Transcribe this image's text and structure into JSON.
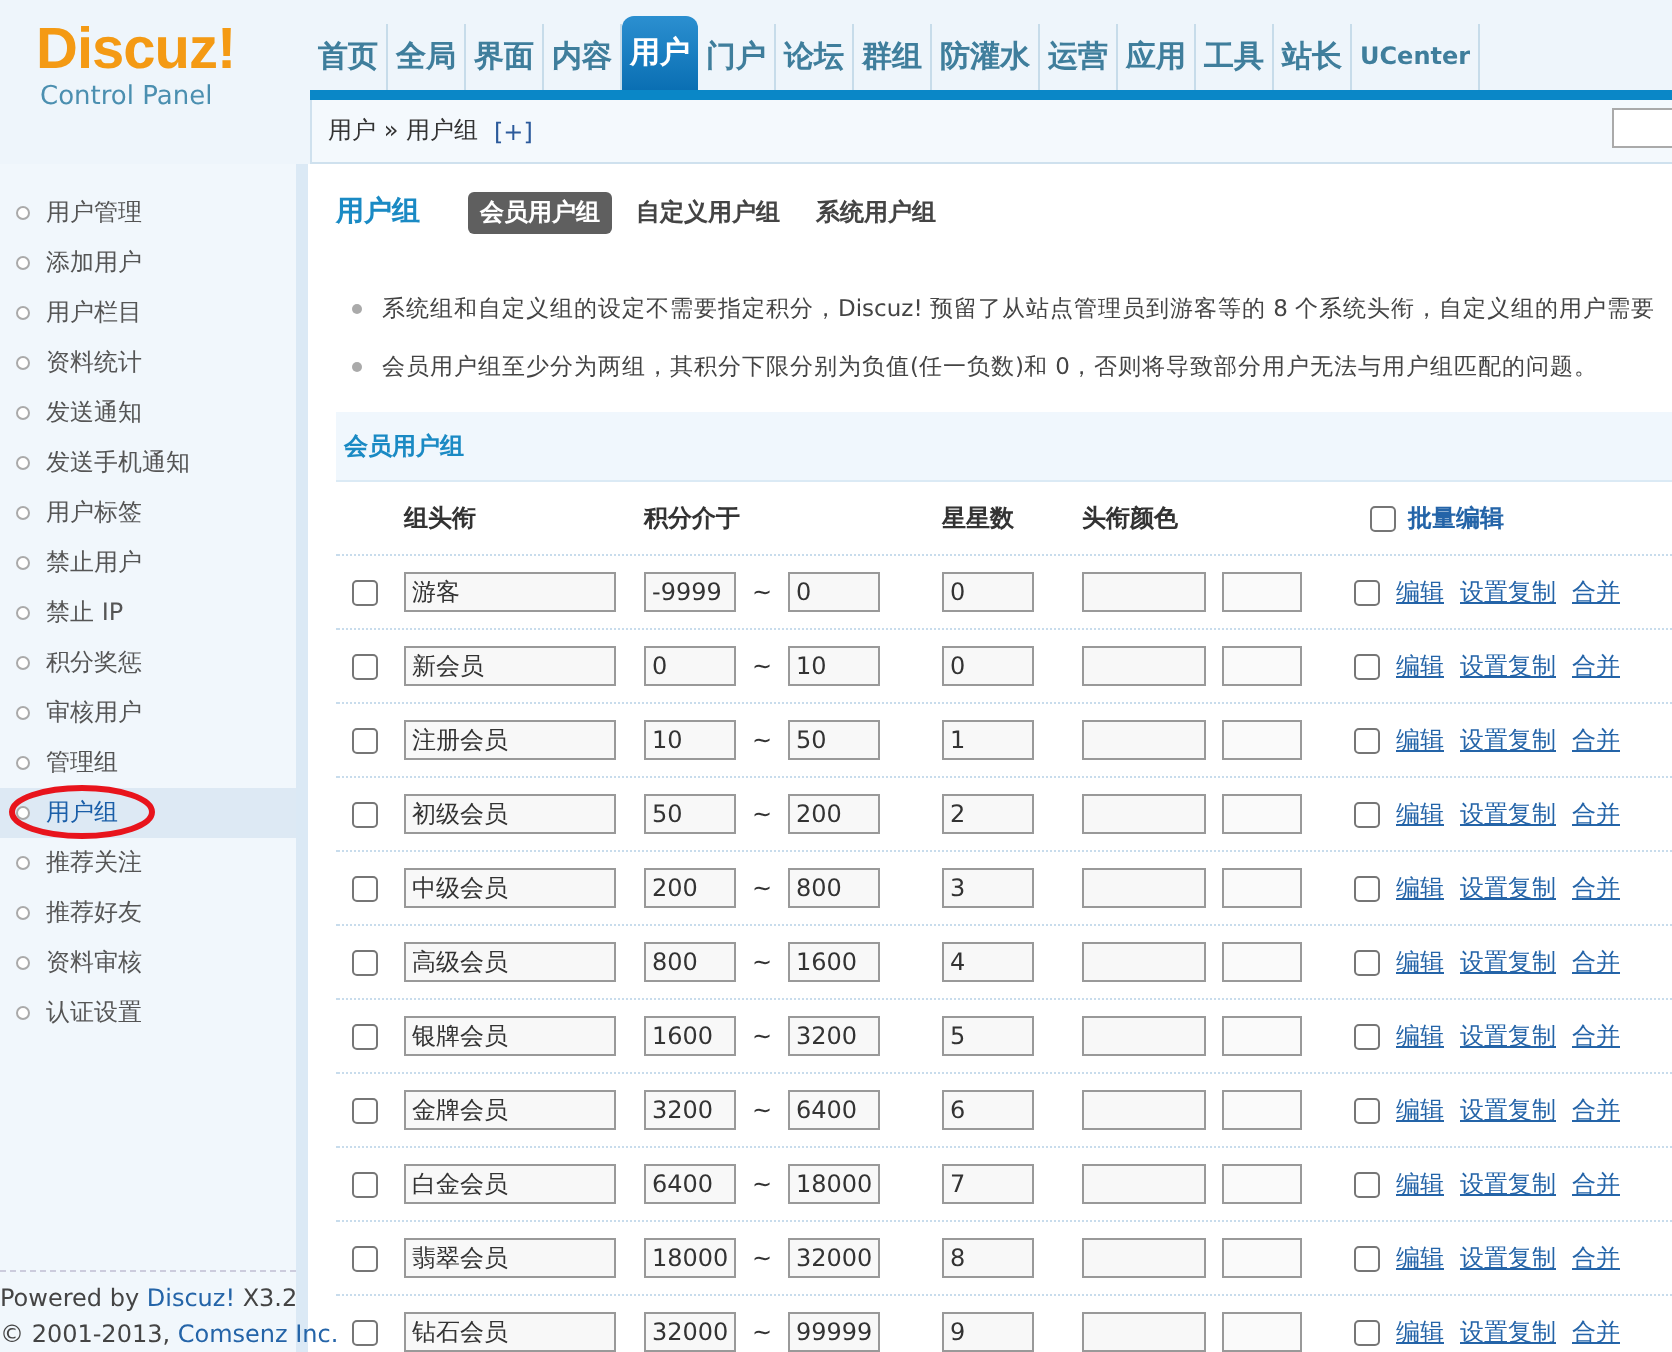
{
  "logo": {
    "name": "Discuz!",
    "subtitle": "Control Panel"
  },
  "nav": [
    {
      "label": "首页",
      "selected": false
    },
    {
      "label": "全局",
      "selected": false
    },
    {
      "label": "界面",
      "selected": false
    },
    {
      "label": "内容",
      "selected": false
    },
    {
      "label": "用户",
      "selected": true
    },
    {
      "label": "门户",
      "selected": false
    },
    {
      "label": "论坛",
      "selected": false
    },
    {
      "label": "群组",
      "selected": false
    },
    {
      "label": "防灌水",
      "selected": false
    },
    {
      "label": "运营",
      "selected": false
    },
    {
      "label": "应用",
      "selected": false
    },
    {
      "label": "工具",
      "selected": false
    },
    {
      "label": "站长",
      "selected": false
    },
    {
      "label": "UCenter",
      "selected": false
    }
  ],
  "breadcrumb": {
    "path": "用户 » 用户组",
    "add": "[+]"
  },
  "sidebar": {
    "items": [
      {
        "label": "用户管理",
        "selected": false,
        "circled": false
      },
      {
        "label": "添加用户",
        "selected": false,
        "circled": false
      },
      {
        "label": "用户栏目",
        "selected": false,
        "circled": false
      },
      {
        "label": "资料统计",
        "selected": false,
        "circled": false
      },
      {
        "label": "发送通知",
        "selected": false,
        "circled": false
      },
      {
        "label": "发送手机通知",
        "selected": false,
        "circled": false
      },
      {
        "label": "用户标签",
        "selected": false,
        "circled": false
      },
      {
        "label": "禁止用户",
        "selected": false,
        "circled": false
      },
      {
        "label": "禁止 IP",
        "selected": false,
        "circled": false
      },
      {
        "label": "积分奖惩",
        "selected": false,
        "circled": false
      },
      {
        "label": "审核用户",
        "selected": false,
        "circled": false
      },
      {
        "label": "管理组",
        "selected": false,
        "circled": false
      },
      {
        "label": "用户组",
        "selected": true,
        "circled": true
      },
      {
        "label": "推荐关注",
        "selected": false,
        "circled": false
      },
      {
        "label": "推荐好友",
        "selected": false,
        "circled": false
      },
      {
        "label": "资料审核",
        "selected": false,
        "circled": false
      },
      {
        "label": "认证设置",
        "selected": false,
        "circled": false
      }
    ],
    "footer": {
      "powered": {
        "prefix": "Powered by",
        "link": "Discuz!",
        "suffix": "X3.2"
      },
      "copyright": {
        "prefix": "© 2001-2013,",
        "link": "Comsenz Inc."
      }
    }
  },
  "page_title": "用户组",
  "tabs": [
    {
      "label": "会员用户组",
      "selected": true
    },
    {
      "label": "自定义用户组",
      "selected": false
    },
    {
      "label": "系统用户组",
      "selected": false
    }
  ],
  "notes": [
    "系统组和自定义组的设定不需要指定积分，Discuz! 预留了从站点管理员到游客等的 8 个系统头衔，自定义组的用户需要",
    "会员用户组至少分为两组，其积分下限分别为负值(任一负数)和 0，否则将导致部分用户无法与用户组匹配的问题。"
  ],
  "section_title": "会员用户组",
  "table": {
    "columns": [
      "组头衔",
      "积分介于",
      "星星数",
      "头衔颜色"
    ],
    "batch": {
      "label": "批量编辑",
      "checked": false
    },
    "rows": [
      {
        "checked": false,
        "name": "游客",
        "min": "-9999",
        "separator": "~",
        "max": "0",
        "star_field": "0",
        "edit_checked": false,
        "actions": [
          "编辑",
          "设置复制",
          "合并"
        ]
      },
      {
        "checked": false,
        "name": "新会员",
        "min": "0",
        "separator": "~",
        "max": "10",
        "star_field": "0",
        "edit_checked": false,
        "actions": [
          "编辑",
          "设置复制",
          "合并"
        ]
      },
      {
        "checked": false,
        "name": "注册会员",
        "min": "10",
        "separator": "~",
        "max": "50",
        "star_field": "1",
        "edit_checked": false,
        "actions": [
          "编辑",
          "设置复制",
          "合并"
        ]
      },
      {
        "checked": false,
        "name": "初级会员",
        "min": "50",
        "separator": "~",
        "max": "200",
        "star_field": "2",
        "edit_checked": false,
        "actions": [
          "编辑",
          "设置复制",
          "合并"
        ]
      },
      {
        "checked": false,
        "name": "中级会员",
        "min": "200",
        "separator": "~",
        "max": "800",
        "star_field": "3",
        "edit_checked": false,
        "actions": [
          "编辑",
          "设置复制",
          "合并"
        ]
      },
      {
        "checked": false,
        "name": "高级会员",
        "min": "800",
        "separator": "~",
        "max": "1600",
        "star_field": "4",
        "edit_checked": false,
        "actions": [
          "编辑",
          "设置复制",
          "合并"
        ]
      },
      {
        "checked": false,
        "name": "银牌会员",
        "min": "1600",
        "separator": "~",
        "max": "3200",
        "star_field": "5",
        "edit_checked": false,
        "actions": [
          "编辑",
          "设置复制",
          "合并"
        ]
      },
      {
        "checked": false,
        "name": "金牌会员",
        "min": "3200",
        "separator": "~",
        "max": "6400",
        "star_field": "6",
        "edit_checked": false,
        "actions": [
          "编辑",
          "设置复制",
          "合并"
        ]
      },
      {
        "checked": false,
        "name": "白金会员",
        "min": "6400",
        "separator": "~",
        "max": "18000",
        "star_field": "7",
        "edit_checked": false,
        "actions": [
          "编辑",
          "设置复制",
          "合并"
        ]
      },
      {
        "checked": false,
        "name": "翡翠会员",
        "min": "18000",
        "separator": "~",
        "max": "32000",
        "star_field": "8",
        "edit_checked": false,
        "actions": [
          "编辑",
          "设置复制",
          "合并"
        ]
      },
      {
        "checked": false,
        "name": "钻石会员",
        "min": "32000",
        "separator": "~",
        "max": "99999",
        "star_field": "9",
        "edit_checked": false,
        "actions": [
          "编辑",
          "设置复制",
          "合并"
        ]
      }
    ]
  }
}
